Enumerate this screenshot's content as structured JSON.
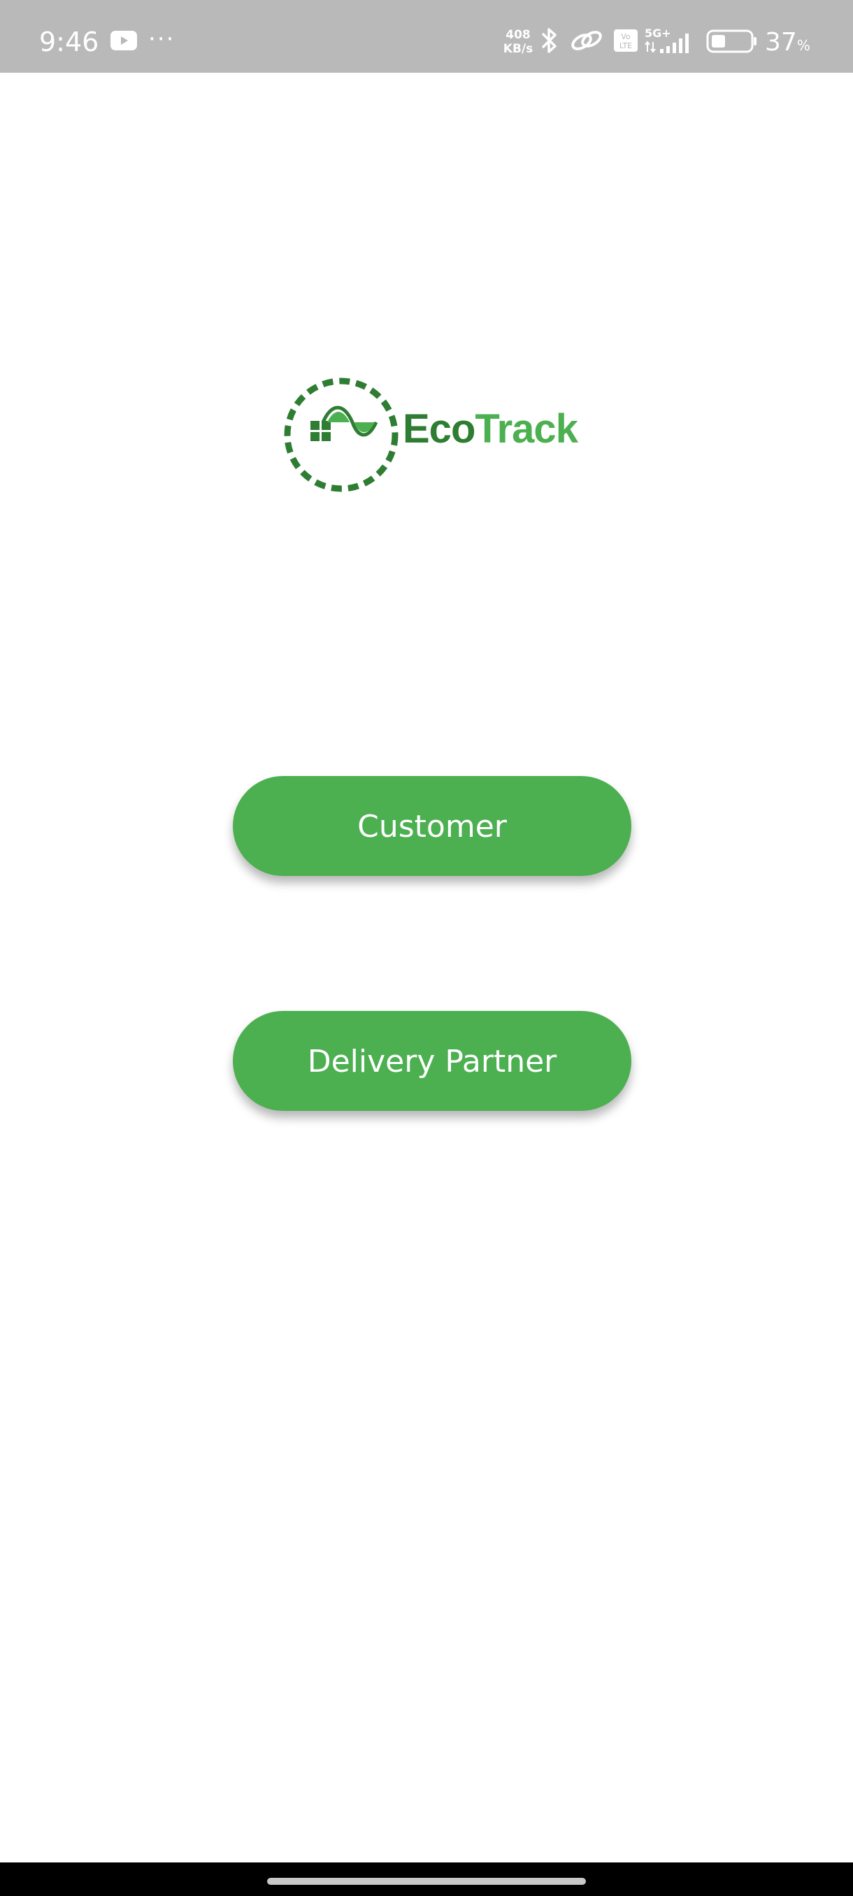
{
  "status_bar": {
    "time": "9:46",
    "youtube_icon": "youtube-icon",
    "more": "···",
    "speed_value": "408",
    "speed_unit": "KB/s",
    "volte": "Vo LTE",
    "network": "5G+",
    "battery_percent": "37",
    "battery_unit": "%",
    "battery_level": 0.37
  },
  "logo": {
    "eco": "Eco",
    "track": "Track",
    "colors": {
      "dark": "#2e7d32",
      "light": "#4caf50"
    }
  },
  "buttons": {
    "customer": "Customer",
    "delivery_partner": "Delivery Partner"
  },
  "theme": {
    "accent": "#4caf50",
    "status_bar_bg": "#b9b9b9",
    "background": "#ffffff"
  }
}
